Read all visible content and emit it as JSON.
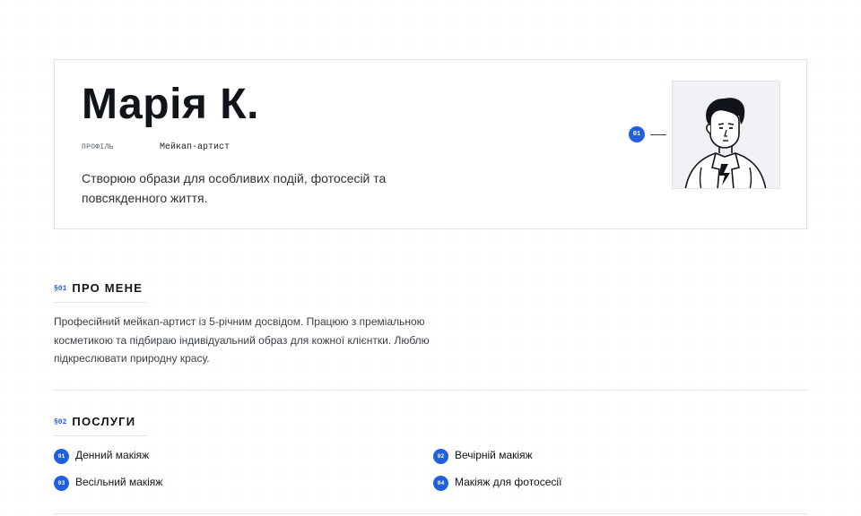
{
  "hero": {
    "name": "Марія К.",
    "profile_label": "ПРОФІЛЬ",
    "profile_value": "Мейкап-артист",
    "description": "Створюю образи для особливих подій, фотосесій та повсякденного життя.",
    "marker": "01",
    "avatar_icon": "person-illustration"
  },
  "about": {
    "number": "§01",
    "title": "ПРО МЕНЕ",
    "text": "Професійний мейкап-артист із 5-річним досвідом. Працюю з преміальною косметикою та підбираю індивідуальний образ для кожної клієнтки. Люблю підкреслювати природну красу."
  },
  "services": {
    "number": "§02",
    "title": "ПОСЛУГИ",
    "items": [
      {
        "num": "01",
        "label": "Денний макіяж"
      },
      {
        "num": "02",
        "label": "Вечірній макіяж"
      },
      {
        "num": "03",
        "label": "Весільний макіяж"
      },
      {
        "num": "04",
        "label": "Макіяж для фотосесії"
      }
    ]
  },
  "colors": {
    "accent": "#1f5fe0",
    "border": "#dfe3ea",
    "text": "#111418"
  }
}
